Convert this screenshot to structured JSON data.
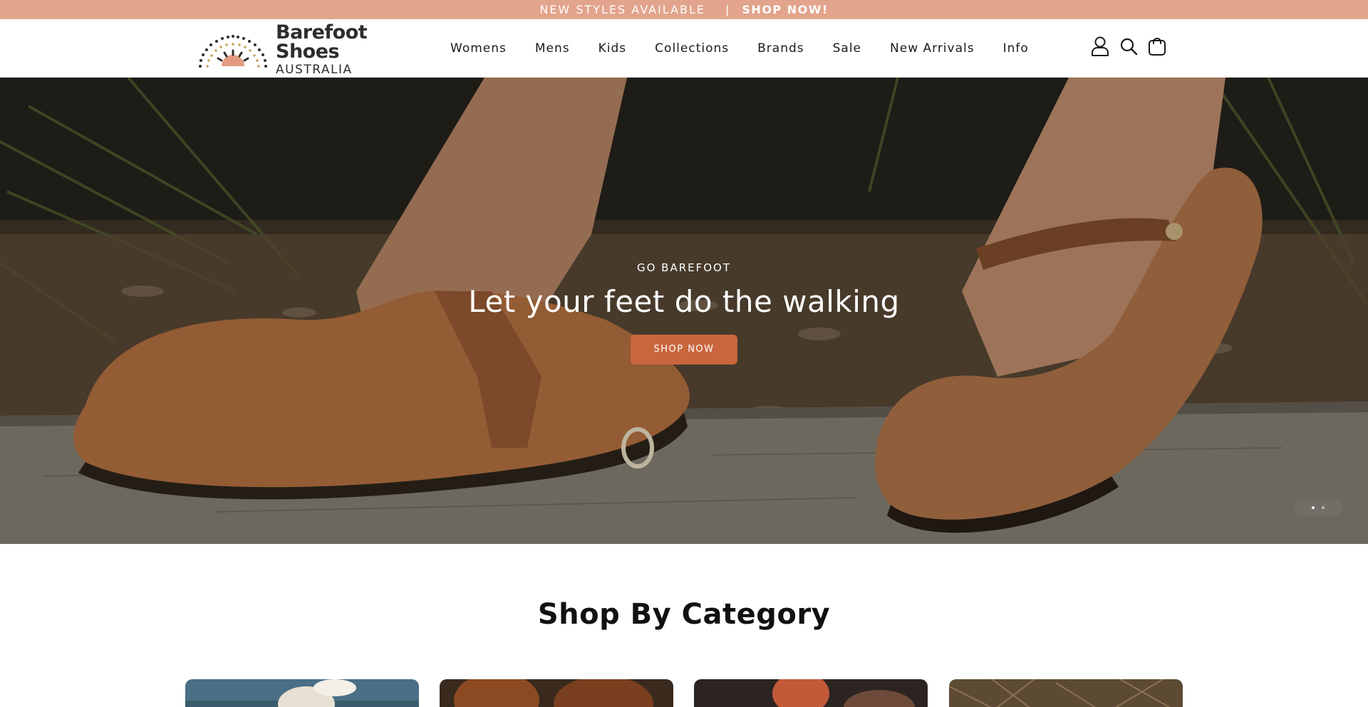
{
  "announcement": {
    "text": "NEW STYLES AVAILABLE",
    "separator": "|",
    "cta": "SHOP NOW!"
  },
  "header": {
    "logo_title": "Barefoot Shoes",
    "logo_subtitle": "AUSTRALIA",
    "nav": [
      "Womens",
      "Mens",
      "Kids",
      "Collections",
      "Brands",
      "Sale",
      "New Arrivals",
      "Info"
    ],
    "icons": [
      "account-icon",
      "search-icon",
      "cart-icon"
    ]
  },
  "hero": {
    "eyebrow": "GO BAREFOOT",
    "title": "Let your feet do the walking",
    "button": "SHOP NOW",
    "slides_total": 2,
    "active_slide": 1
  },
  "categories": {
    "heading": "Shop By Category"
  },
  "colors": {
    "announcement_bg": "#e2a48c",
    "button_bg": "#c9663e"
  }
}
